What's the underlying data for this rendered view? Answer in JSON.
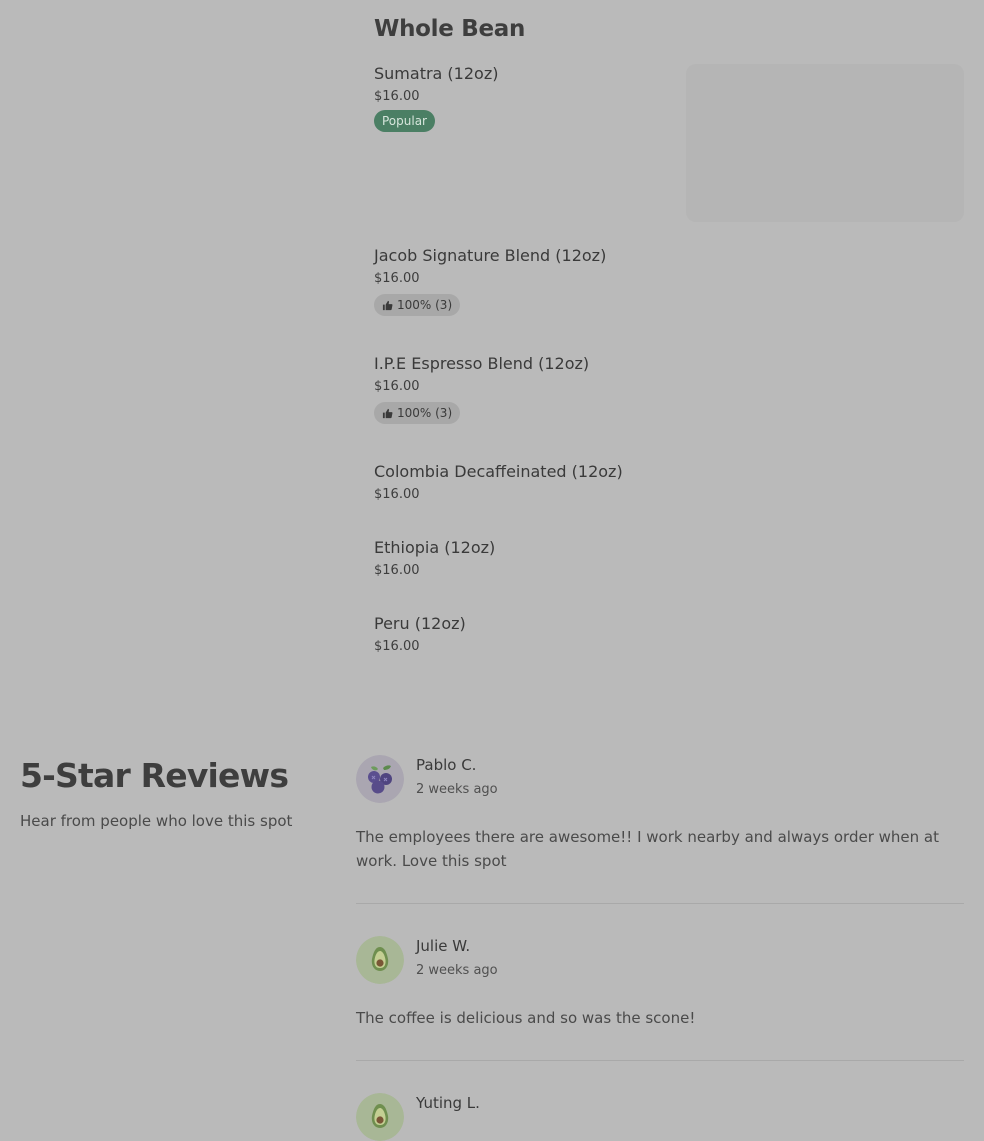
{
  "menu": {
    "section_title": "Whole Bean",
    "items": [
      {
        "name": "Sumatra (12oz)",
        "price": "$16.00",
        "badge": "Popular"
      },
      {
        "name": "Jacob Signature Blend (12oz)",
        "price": "$16.00",
        "rating": "100% (3)"
      },
      {
        "name": "I.P.E Espresso Blend (12oz)",
        "price": "$16.00",
        "rating": "100% (3)"
      },
      {
        "name": "Colombia Decaffeinated (12oz)",
        "price": "$16.00"
      },
      {
        "name": "Ethiopia (12oz)",
        "price": "$16.00"
      },
      {
        "name": "Peru (12oz)",
        "price": "$16.00"
      }
    ]
  },
  "reviews": {
    "heading": "5-Star Reviews",
    "subtitle": "Hear from people who love this spot",
    "items": [
      {
        "name": "Pablo C.",
        "date": "2 weeks ago",
        "text": "The employees there are awesome!! I work nearby and always order when at work. Love this spot",
        "avatar_icon": "blueberry-icon"
      },
      {
        "name": "Julie W.",
        "date": "2 weeks ago",
        "text": "The coffee is delicious and so was the scone!",
        "avatar_icon": "avocado-icon"
      },
      {
        "name": "Yuting L.",
        "avatar_icon": "avocado-icon"
      }
    ]
  },
  "colors": {
    "background": "#bababa",
    "popular_badge": "#4b7f64",
    "rating_badge": "#a8a8a8"
  }
}
